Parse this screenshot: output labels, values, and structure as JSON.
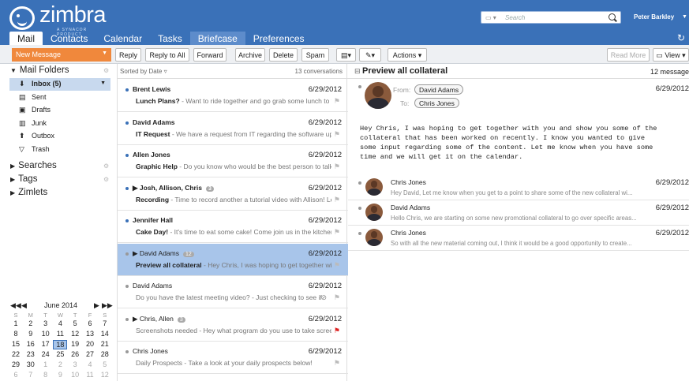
{
  "app": {
    "logo_text": "zimbra",
    "logo_sub": "A SYNACOR PRODUCT",
    "search_type": "▾",
    "search_placeholder": "Search",
    "user": "Peter Barkley"
  },
  "tabs": [
    "Mail",
    "Contacts",
    "Calendar",
    "Tasks",
    "Briefcase",
    "Preferences"
  ],
  "toolbar": {
    "new_message": "New Message",
    "buttons": [
      "Reply",
      "Reply to All",
      "Forward",
      "Archive",
      "Delete",
      "Spam",
      "Actions"
    ],
    "read_more": "Read More",
    "view": "View"
  },
  "sidebar": {
    "mail_folders": "Mail Folders",
    "folders": [
      {
        "label": "Inbox (5)",
        "icon": "inbox-icon"
      },
      {
        "label": "Sent",
        "icon": "sent-icon"
      },
      {
        "label": "Drafts",
        "icon": "drafts-icon"
      },
      {
        "label": "Junk",
        "icon": "junk-icon"
      },
      {
        "label": "Outbox",
        "icon": "outbox-icon"
      },
      {
        "label": "Trash",
        "icon": "trash-icon"
      }
    ],
    "searches": "Searches",
    "tags": "Tags",
    "zimlets": "Zimlets"
  },
  "calendar": {
    "month": "June 2014",
    "weekdays": [
      "S",
      "M",
      "T",
      "W",
      "T",
      "F",
      "S"
    ],
    "weeks": [
      [
        "1",
        "2",
        "3",
        "4",
        "5",
        "6",
        "7"
      ],
      [
        "8",
        "9",
        "10",
        "11",
        "12",
        "13",
        "14"
      ],
      [
        "15",
        "16",
        "17",
        "18",
        "19",
        "20",
        "21"
      ],
      [
        "22",
        "23",
        "24",
        "25",
        "26",
        "27",
        "28"
      ],
      [
        "29",
        "30",
        "1",
        "2",
        "3",
        "4",
        "5"
      ],
      [
        "6",
        "7",
        "8",
        "9",
        "10",
        "11",
        "12"
      ]
    ],
    "today": "18"
  },
  "list": {
    "sort": "Sorted by Date",
    "count": "13 conversations",
    "items": [
      {
        "sender": "Brent Lewis",
        "date": "6/29/2012",
        "subject": "Lunch Plans?",
        "fragment": " - Want to ride together and go grab some lunch to talk"
      },
      {
        "sender": "David Adams",
        "date": "6/29/2012",
        "subject": "IT Request",
        "fragment": " - We have a request from IT regarding the software upda"
      },
      {
        "sender": "Allen Jones",
        "date": "6/29/2012",
        "subject": "Graphic Help",
        "fragment": " - Do you know who would be the best person to talk t"
      },
      {
        "sender": "▶ Josh, Allison, Chris",
        "date": "6/29/2012",
        "subject": "Recording",
        "fragment": " - Time to record another a tutorial video with Allison! Let",
        "count": "3"
      },
      {
        "sender": "Jennifer Hall",
        "date": "6/29/2012",
        "subject": "Cake Day!",
        "fragment": " - It's time to eat some cake! Come join us in the kitchen a"
      },
      {
        "sender": "▶ David Adams",
        "date": "6/29/2012",
        "subject": "Preview all collateral",
        "fragment": " - Hey Chris, I was hoping to get together with",
        "count": "12"
      },
      {
        "sender": "David Adams",
        "date": "6/29/2012",
        "subject": "",
        "fragment": "Do you have the latest meeting video? - Just checking to see if"
      },
      {
        "sender": "▶ Chris, Allen",
        "date": "6/29/2012",
        "subject": "",
        "fragment": "Screenshots needed - Hey what program do you use to take screensh",
        "count": "3"
      },
      {
        "sender": "Chris Jones",
        "date": "6/29/2012",
        "subject": "",
        "fragment": "Daily Prospects - Take a look at your daily prospects below!"
      }
    ]
  },
  "reading": {
    "title": "Preview all collateral",
    "count": "12 message",
    "from_label": "From:",
    "from": "David Adams",
    "to_label": "To:",
    "to": "Chris Jones",
    "date": "6/29/2012",
    "body": "Hey Chris, I was hoping to get together with you and show you some of the\ncollateral that has been worked on recently. I know you wanted to give\nsome input regarding some of the content. Let me know when you have some\ntime and we will get it on the calendar.",
    "replies": [
      {
        "name": "Chris Jones",
        "date": "6/29/2012",
        "snippet": "Hey David, Let me know when you get to a point to share some of the new collateral wi..."
      },
      {
        "name": "David Adams",
        "date": "6/29/2012",
        "snippet": "Hello Chris, we are starting on some new promotional collateral to go over specific areas..."
      },
      {
        "name": "Chris Jones",
        "date": "6/29/2012",
        "snippet": "So with all the new material coming out, I think it would be a good opportunity to create..."
      }
    ]
  },
  "colors": {
    "header": "#3a71b8",
    "new_message": "#f0883c",
    "selection": "#a8c5ea"
  }
}
